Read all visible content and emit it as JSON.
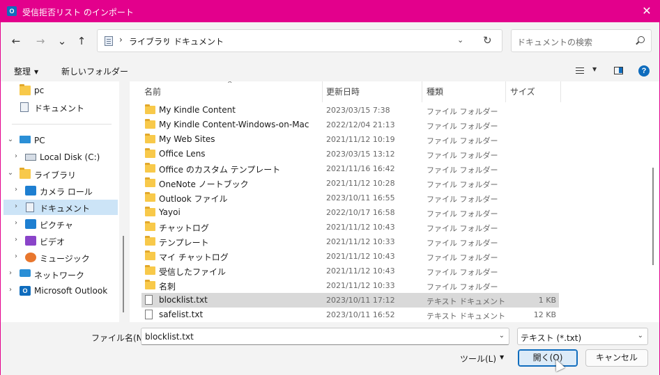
{
  "window": {
    "title": "受信拒否リスト のインポート",
    "app_icon": "outlook-icon",
    "accent": "#e3008c",
    "close_glyph": "✕"
  },
  "nav": {
    "back_glyph": "←",
    "forward_glyph": "→",
    "recent_glyph": "⌄",
    "up_glyph": "↑",
    "breadcrumbs": [
      "ライブラリ",
      "ドキュメント"
    ],
    "crumb_sep": "›",
    "dropdown_glyph": "⌄",
    "refresh_glyph": "↻",
    "search_placeholder": "ドキュメントの検索"
  },
  "toolbar": {
    "organize_label": "整理",
    "caret": "▼",
    "new_folder_label": "新しいフォルダー",
    "help_label": "?"
  },
  "sidebar": {
    "items": [
      {
        "label": "pc",
        "icon": "folder-icon",
        "chevron": ""
      },
      {
        "label": "ドキュメント",
        "icon": "document-icon",
        "chevron": ""
      },
      {
        "label": "PC",
        "icon": "pc-icon",
        "chevron": "⌄"
      },
      {
        "label": "Local Disk (C:)",
        "icon": "drive-icon",
        "chevron": "›"
      },
      {
        "label": "ライブラリ",
        "icon": "folder-icon",
        "chevron": "⌄"
      },
      {
        "label": "カメラ ロール",
        "icon": "camera-roll-icon",
        "chevron": "›"
      },
      {
        "label": "ドキュメント",
        "icon": "document-icon",
        "chevron": "›"
      },
      {
        "label": "ピクチャ",
        "icon": "pictures-icon",
        "chevron": "›"
      },
      {
        "label": "ビデオ",
        "icon": "video-icon",
        "chevron": "›"
      },
      {
        "label": "ミュージック",
        "icon": "music-icon",
        "chevron": "›"
      },
      {
        "label": "ネットワーク",
        "icon": "network-icon",
        "chevron": "›"
      },
      {
        "label": "Microsoft Outlook",
        "icon": "outlook-icon",
        "chevron": "›"
      }
    ]
  },
  "filelist": {
    "columns": [
      "名前",
      "更新日時",
      "種類",
      "サイズ"
    ],
    "sort_glyph": "^",
    "rows": [
      {
        "name": "My Kindle Content",
        "date": "2023/03/15 7:38",
        "type": "ファイル フォルダー",
        "size": "",
        "icon": "folder-icon"
      },
      {
        "name": "My Kindle Content-Windows-on-Mac",
        "date": "2022/12/04 21:13",
        "type": "ファイル フォルダー",
        "size": "",
        "icon": "folder-icon"
      },
      {
        "name": "My Web Sites",
        "date": "2021/11/12 10:19",
        "type": "ファイル フォルダー",
        "size": "",
        "icon": "folder-icon"
      },
      {
        "name": "Office Lens",
        "date": "2023/03/15 13:12",
        "type": "ファイル フォルダー",
        "size": "",
        "icon": "folder-icon"
      },
      {
        "name": "Office のカスタム テンプレート",
        "date": "2021/11/16 16:42",
        "type": "ファイル フォルダー",
        "size": "",
        "icon": "folder-icon"
      },
      {
        "name": "OneNote ノートブック",
        "date": "2021/11/12 10:28",
        "type": "ファイル フォルダー",
        "size": "",
        "icon": "folder-icon"
      },
      {
        "name": "Outlook ファイル",
        "date": "2023/10/11 16:55",
        "type": "ファイル フォルダー",
        "size": "",
        "icon": "folder-icon"
      },
      {
        "name": "Yayoi",
        "date": "2022/10/17 16:58",
        "type": "ファイル フォルダー",
        "size": "",
        "icon": "folder-icon"
      },
      {
        "name": "チャットログ",
        "date": "2021/11/12 10:43",
        "type": "ファイル フォルダー",
        "size": "",
        "icon": "folder-icon"
      },
      {
        "name": "テンプレート",
        "date": "2021/11/12 10:33",
        "type": "ファイル フォルダー",
        "size": "",
        "icon": "folder-icon"
      },
      {
        "name": "マイ チャットログ",
        "date": "2021/11/12 10:43",
        "type": "ファイル フォルダー",
        "size": "",
        "icon": "folder-icon"
      },
      {
        "name": "受信したファイル",
        "date": "2021/11/12 10:43",
        "type": "ファイル フォルダー",
        "size": "",
        "icon": "folder-icon"
      },
      {
        "name": "名刺",
        "date": "2021/11/12 10:33",
        "type": "ファイル フォルダー",
        "size": "",
        "icon": "folder-icon"
      },
      {
        "name": "blocklist.txt",
        "date": "2023/10/11 17:12",
        "type": "テキスト ドキュメント",
        "size": "1 KB",
        "icon": "text-file-icon"
      },
      {
        "name": "safelist.txt",
        "date": "2023/10/11 16:52",
        "type": "テキスト ドキュメント",
        "size": "12 KB",
        "icon": "text-file-icon"
      }
    ]
  },
  "bottom": {
    "filename_label": "ファイル名(N):",
    "filename_value": "blocklist.txt",
    "filetype_value": "テキスト (*.txt)",
    "dropdown_glyph": "⌄",
    "tools_label": "ツール(L)",
    "tools_caret": "▼",
    "open_label": "開く(O)",
    "cancel_label": "キャンセル"
  }
}
